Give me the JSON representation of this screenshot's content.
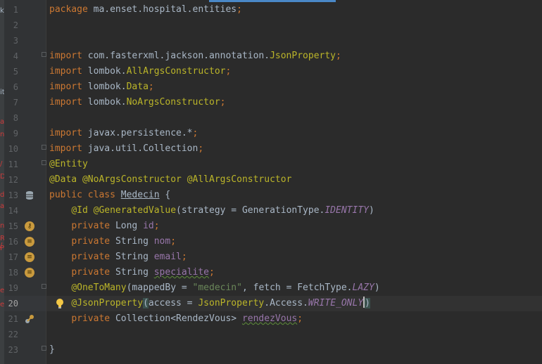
{
  "left_strip": {
    "chars": [
      {
        "text": "k",
        "color": "#a9b7c6"
      },
      {
        "text": "it",
        "color": "#a9b7c6"
      },
      {
        "text": "a",
        "color": "#cc3a3a"
      },
      {
        "text": "n",
        "color": "#cc3a3a"
      },
      {
        "text": "/",
        "color": "#cc3a3a"
      },
      {
        "text": "D",
        "color": "#cc3a3a"
      },
      {
        "text": "d",
        "color": "#cc3a3a"
      },
      {
        "text": "a",
        "color": "#cc3a3a"
      },
      {
        "text": "n",
        "color": "#cc3a3a"
      },
      {
        "text": "R",
        "color": "#cc3a3a"
      },
      {
        "text": "/",
        "color": "#cc3a3a"
      },
      {
        "text": "P",
        "color": "#cc3a3a"
      },
      {
        "text": "e",
        "color": "#cc3a3a"
      },
      {
        "text": "e",
        "color": "#cc3a3a"
      }
    ]
  },
  "editor": {
    "current_line": "20",
    "lines": [
      {
        "number": "1",
        "tokens": [
          [
            "package ",
            "kw"
          ],
          [
            "ma.enset.hospital.entities",
            ""
          ],
          [
            ";",
            "punct"
          ]
        ]
      },
      {
        "number": "2",
        "tokens": []
      },
      {
        "number": "3",
        "tokens": []
      },
      {
        "number": "4",
        "tokens": [
          [
            "import ",
            "kw"
          ],
          [
            "com.fasterxml.jackson.annotation.",
            ""
          ],
          [
            "JsonProperty",
            "ann"
          ],
          [
            ";",
            "punct"
          ]
        ]
      },
      {
        "number": "5",
        "tokens": [
          [
            "import ",
            "kw"
          ],
          [
            "lombok.",
            ""
          ],
          [
            "AllArgsConstructor",
            "ann"
          ],
          [
            ";",
            "punct"
          ]
        ]
      },
      {
        "number": "6",
        "tokens": [
          [
            "import ",
            "kw"
          ],
          [
            "lombok.",
            ""
          ],
          [
            "Data",
            "ann"
          ],
          [
            ";",
            "punct"
          ]
        ]
      },
      {
        "number": "7",
        "tokens": [
          [
            "import ",
            "kw"
          ],
          [
            "lombok.",
            ""
          ],
          [
            "NoArgsConstructor",
            "ann"
          ],
          [
            ";",
            "punct"
          ]
        ]
      },
      {
        "number": "8",
        "tokens": []
      },
      {
        "number": "9",
        "tokens": [
          [
            "import ",
            "kw"
          ],
          [
            "javax.persistence.*",
            ""
          ],
          [
            ";",
            "punct"
          ]
        ]
      },
      {
        "number": "10",
        "tokens": [
          [
            "import ",
            "kw"
          ],
          [
            "java.util.Collection",
            ""
          ],
          [
            ";",
            "punct"
          ]
        ]
      },
      {
        "number": "11",
        "tokens": [
          [
            "@Entity",
            "ann"
          ]
        ]
      },
      {
        "number": "12",
        "tokens": [
          [
            "@Data ",
            "ann"
          ],
          [
            "@NoArgsConstructor ",
            "ann"
          ],
          [
            "@AllArgsConstructor",
            "ann"
          ]
        ]
      },
      {
        "number": "13",
        "tokens": [
          [
            "public class ",
            "kw"
          ],
          [
            "Medecin",
            "underline-plain"
          ],
          [
            " {",
            ""
          ]
        ]
      },
      {
        "number": "14",
        "tokens": [
          [
            "    ",
            ""
          ],
          [
            "@Id ",
            "ann"
          ],
          [
            "@GeneratedValue",
            "ann"
          ],
          [
            "(strategy = GenerationType.",
            ""
          ],
          [
            "IDENTITY",
            "italic"
          ],
          [
            ")",
            ""
          ]
        ]
      },
      {
        "number": "15",
        "tokens": [
          [
            "    ",
            ""
          ],
          [
            "private ",
            "kw"
          ],
          [
            "Long ",
            ""
          ],
          [
            "id",
            "field"
          ],
          [
            ";",
            "punct"
          ]
        ]
      },
      {
        "number": "16",
        "tokens": [
          [
            "    ",
            ""
          ],
          [
            "private ",
            "kw"
          ],
          [
            "String ",
            ""
          ],
          [
            "nom",
            "field"
          ],
          [
            ";",
            "punct"
          ]
        ]
      },
      {
        "number": "17",
        "tokens": [
          [
            "    ",
            ""
          ],
          [
            "private ",
            "kw"
          ],
          [
            "String ",
            ""
          ],
          [
            "email",
            "field"
          ],
          [
            ";",
            "punct"
          ]
        ]
      },
      {
        "number": "18",
        "tokens": [
          [
            "    ",
            ""
          ],
          [
            "private ",
            "kw"
          ],
          [
            "String ",
            ""
          ],
          [
            "specialite",
            "field underline-green"
          ],
          [
            ";",
            "punct"
          ]
        ]
      },
      {
        "number": "19",
        "tokens": [
          [
            "    ",
            ""
          ],
          [
            "@OneToMany",
            "ann"
          ],
          [
            "(mappedBy = ",
            ""
          ],
          [
            "\"medecin\"",
            "str"
          ],
          [
            ", fetch = FetchType.",
            ""
          ],
          [
            "LAZY",
            "italic"
          ],
          [
            ")",
            ""
          ]
        ]
      },
      {
        "number": "20",
        "tokens": [
          [
            "    ",
            ""
          ],
          [
            "@JsonProperty",
            "ann"
          ],
          [
            "(",
            "hl-bg"
          ],
          [
            "access = ",
            ""
          ],
          [
            "JsonProperty",
            "ann"
          ],
          [
            ".Access.",
            ""
          ],
          [
            "WRITE_ONLY",
            "italic"
          ],
          [
            ")",
            "hl-bg caret-before"
          ]
        ]
      },
      {
        "number": "21",
        "tokens": [
          [
            "    ",
            ""
          ],
          [
            "private ",
            "kw"
          ],
          [
            "Collection<RendezVous> ",
            ""
          ],
          [
            "rendezVous",
            "field underline-green"
          ],
          [
            ";",
            "punct"
          ]
        ]
      },
      {
        "number": "22",
        "tokens": []
      },
      {
        "number": "23",
        "tokens": [
          [
            "}",
            ""
          ]
        ]
      }
    ]
  },
  "gutter_icons": [
    {
      "line": "13",
      "icon": "entity-table-icon"
    },
    {
      "line": "15",
      "icon": "id-column-icon",
      "glyph": "⚷"
    },
    {
      "line": "16",
      "icon": "column-icon",
      "glyph": "≡"
    },
    {
      "line": "17",
      "icon": "column-icon",
      "glyph": "≡"
    },
    {
      "line": "18",
      "icon": "column-icon",
      "glyph": "≡"
    },
    {
      "line": "20",
      "icon": "lightbulb-icon"
    },
    {
      "line": "21",
      "icon": "relationship-icon"
    }
  ]
}
